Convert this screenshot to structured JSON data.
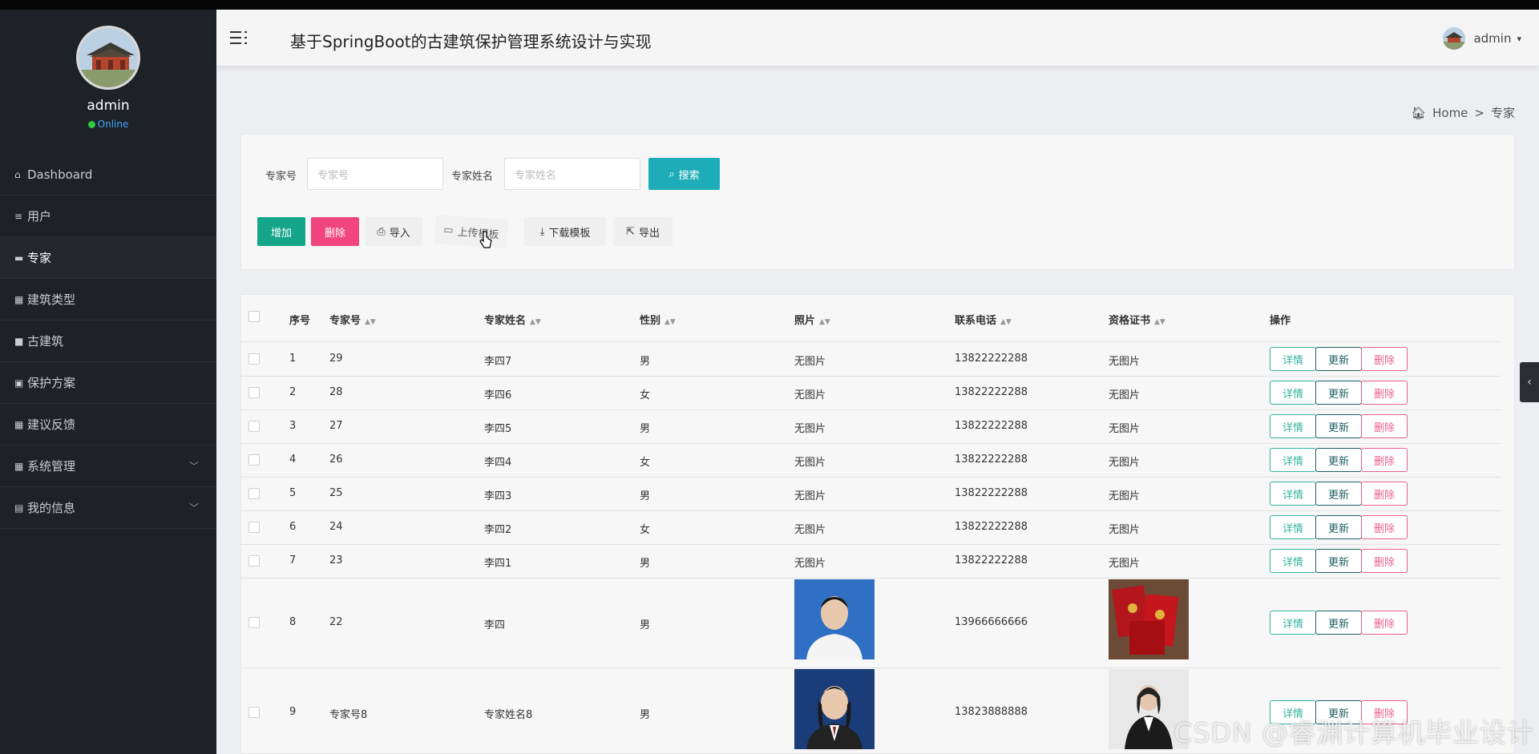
{
  "app": {
    "title": "基于SpringBoot的古建筑保护管理系统设计与实现"
  },
  "user": {
    "name": "admin"
  },
  "sidebar": {
    "profile": {
      "name": "admin",
      "status": "Online"
    },
    "items": [
      {
        "label": "Dashboard",
        "icon": "home-icon"
      },
      {
        "label": "用户",
        "icon": "list-icon"
      },
      {
        "label": "专家",
        "icon": "ticket-icon"
      },
      {
        "label": "建筑类型",
        "icon": "grid-icon"
      },
      {
        "label": "古建筑",
        "icon": "square-icon"
      },
      {
        "label": "保护方案",
        "icon": "calendar-icon"
      },
      {
        "label": "建议反馈",
        "icon": "grid-icon"
      },
      {
        "label": "系统管理",
        "icon": "grid-icon"
      },
      {
        "label": "我的信息",
        "icon": "card-icon"
      }
    ]
  },
  "breadcrumb": {
    "home": "Home",
    "separator": ">",
    "current": "专家"
  },
  "search": {
    "field1_label": "专家号",
    "field1_placeholder": "专家号",
    "field2_label": "专家姓名",
    "field2_placeholder": "专家姓名",
    "search_button": "搜索"
  },
  "toolbar": {
    "add": "增加",
    "delete": "删除",
    "import": "导入",
    "upload_template": "上传模板",
    "download_template": "下载模板",
    "export": "导出"
  },
  "table": {
    "headers": [
      "序号",
      "专家号",
      "专家姓名",
      "性别",
      "照片",
      "联系电话",
      "资格证书",
      "操作"
    ],
    "actions": {
      "detail": "详情",
      "update": "更新",
      "delete": "删除"
    },
    "rows": [
      {
        "index": "1",
        "code": "29",
        "name": "李四7",
        "gender": "男",
        "photo": "无图片",
        "phone": "13822222288",
        "cert": "无图片"
      },
      {
        "index": "2",
        "code": "28",
        "name": "李四6",
        "gender": "女",
        "photo": "无图片",
        "phone": "13822222288",
        "cert": "无图片"
      },
      {
        "index": "3",
        "code": "27",
        "name": "李四5",
        "gender": "男",
        "photo": "无图片",
        "phone": "13822222288",
        "cert": "无图片"
      },
      {
        "index": "4",
        "code": "26",
        "name": "李四4",
        "gender": "女",
        "photo": "无图片",
        "phone": "13822222288",
        "cert": "无图片"
      },
      {
        "index": "5",
        "code": "25",
        "name": "李四3",
        "gender": "男",
        "photo": "无图片",
        "phone": "13822222288",
        "cert": "无图片"
      },
      {
        "index": "6",
        "code": "24",
        "name": "李四2",
        "gender": "女",
        "photo": "无图片",
        "phone": "13822222288",
        "cert": "无图片"
      },
      {
        "index": "7",
        "code": "23",
        "name": "李四1",
        "gender": "男",
        "photo": "无图片",
        "phone": "13822222288",
        "cert": "无图片"
      },
      {
        "index": "8",
        "code": "22",
        "name": "李四",
        "gender": "男",
        "photo": "",
        "phone": "13966666666",
        "cert": ""
      },
      {
        "index": "9",
        "code": "专家号8",
        "name": "专家姓名8",
        "gender": "男",
        "photo": "",
        "phone": "13823888888",
        "cert": ""
      }
    ]
  },
  "watermark": "CSDN @睿渊计算机毕业设计",
  "colors": {
    "sidebar_bg": "#1e2125",
    "search_btn": "#1eadb8",
    "add_btn": "#15a68a",
    "delete_btn": "#f0457f"
  }
}
